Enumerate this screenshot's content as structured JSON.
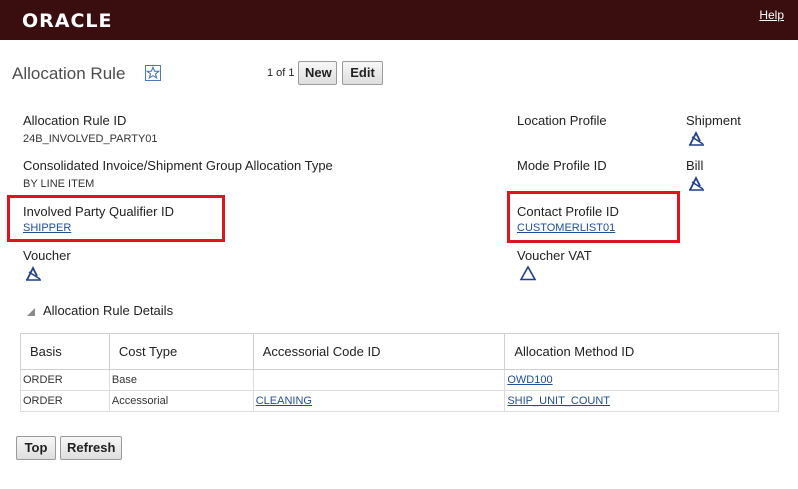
{
  "header": {
    "logo": "ORACLE",
    "help": "Help"
  },
  "page": {
    "title": "Allocation Rule",
    "pager": "1 of 1"
  },
  "toolbar": {
    "new_label": "New",
    "edit_label": "Edit"
  },
  "fields": {
    "allocation_rule_id": {
      "label": "Allocation Rule ID",
      "value": "24B_INVOLVED_PARTY01"
    },
    "consolidated_type": {
      "label": "Consolidated Invoice/Shipment Group Allocation Type",
      "value": "BY LINE ITEM"
    },
    "involved_party": {
      "label": "Involved Party Qualifier ID",
      "value": "SHIPPER"
    },
    "voucher": {
      "label": "Voucher"
    },
    "location_profile": {
      "label": "Location Profile"
    },
    "mode_profile": {
      "label": "Mode Profile ID"
    },
    "contact_profile": {
      "label": "Contact Profile ID",
      "value": "CUSTOMERLIST01"
    },
    "voucher_vat": {
      "label": "Voucher VAT"
    },
    "shipment": {
      "label": "Shipment"
    },
    "bill": {
      "label": "Bill"
    }
  },
  "details": {
    "title": "Allocation Rule Details",
    "columns": [
      "Basis",
      "Cost Type",
      "Accessorial Code ID",
      "Allocation Method ID"
    ],
    "rows": [
      [
        "ORDER",
        "Base",
        "",
        "OWD100"
      ],
      [
        "ORDER",
        "Accessorial",
        "CLEANING",
        "SHIP_UNIT_COUNT"
      ]
    ]
  },
  "footer": {
    "top_label": "Top",
    "refresh_label": "Refresh"
  },
  "colors": {
    "header_bg": "#3a0d0f",
    "link": "#1f4e9a",
    "highlight": "#e0141e"
  }
}
